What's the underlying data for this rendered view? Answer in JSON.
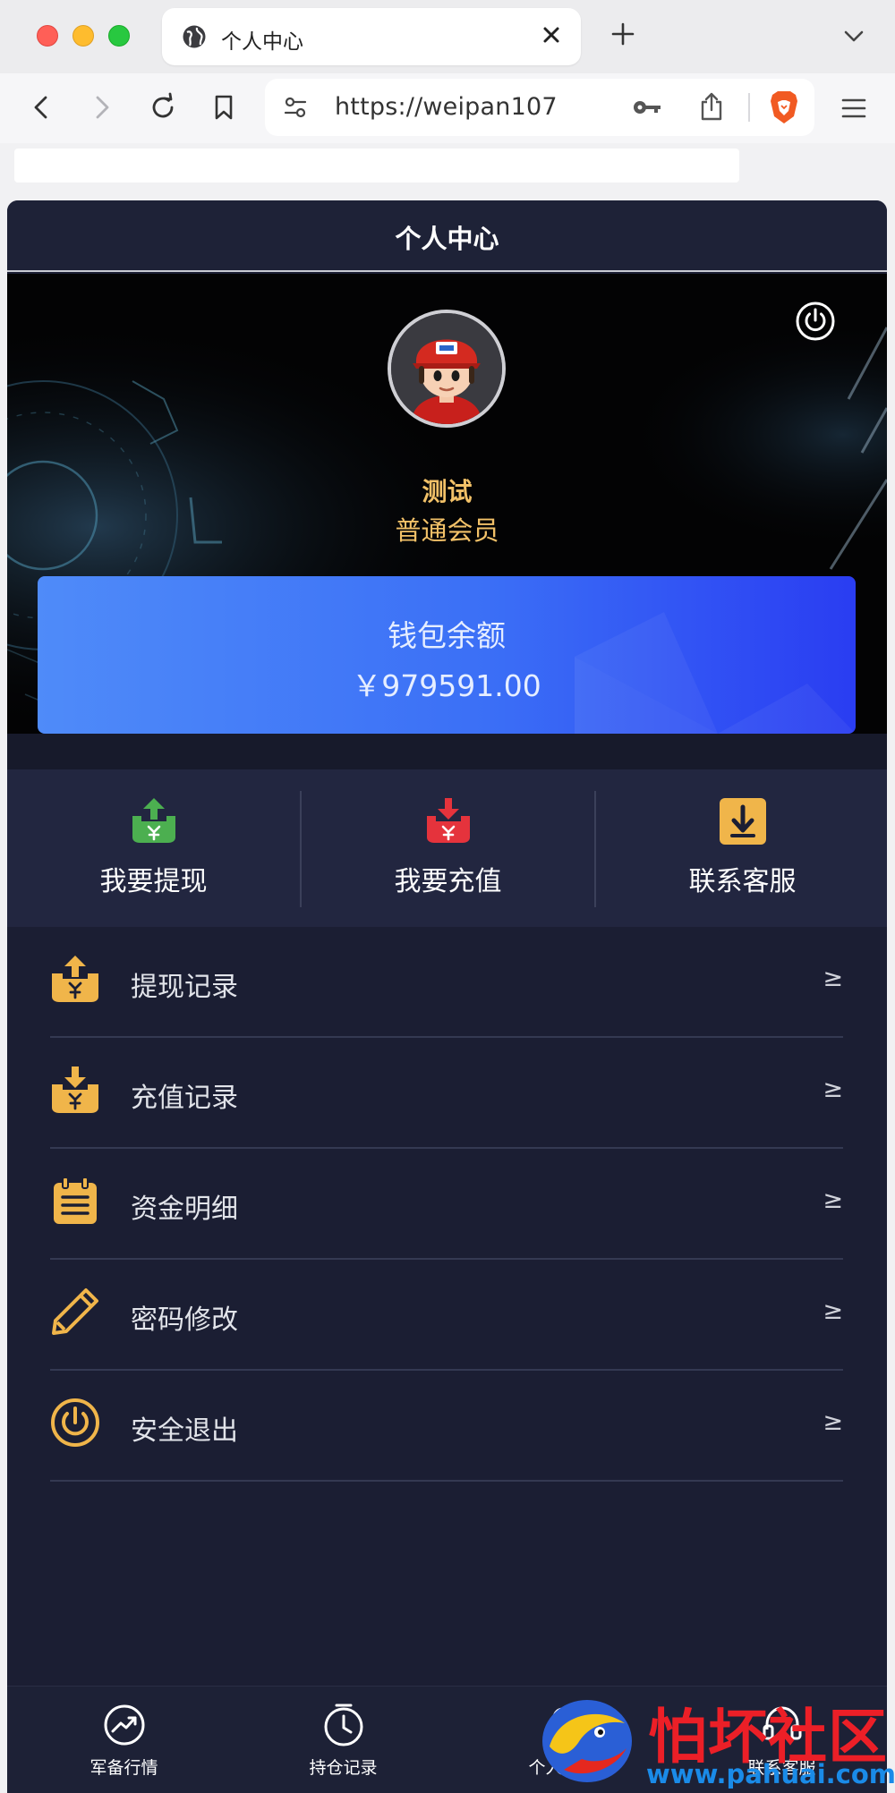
{
  "browser": {
    "tab_title": "个人中心",
    "url": "https://weipan107"
  },
  "header": {
    "title": "个人中心"
  },
  "profile": {
    "username": "测试",
    "member_level": "普通会员"
  },
  "wallet": {
    "label": "钱包余额",
    "amount": "￥979591.00"
  },
  "actions": [
    {
      "label": "我要提现",
      "icon": "withdraw-icon",
      "color": "#4caf50"
    },
    {
      "label": "我要充值",
      "icon": "recharge-icon",
      "color": "#e5333c"
    },
    {
      "label": "联系客服",
      "icon": "download-box-icon",
      "color": "#f0b54a"
    }
  ],
  "menu": [
    {
      "label": "提现记录",
      "icon": "withdraw-record-icon",
      "chevron": "≥"
    },
    {
      "label": "充值记录",
      "icon": "recharge-record-icon",
      "chevron": "≥"
    },
    {
      "label": "资金明细",
      "icon": "clipboard-icon",
      "chevron": "≥"
    },
    {
      "label": "密码修改",
      "icon": "pencil-icon",
      "chevron": "≥"
    },
    {
      "label": "安全退出",
      "icon": "power-icon",
      "chevron": "≥"
    }
  ],
  "bottom_nav": [
    {
      "label": "军备行情",
      "icon": "trend-icon"
    },
    {
      "label": "持仓记录",
      "icon": "clock-icon"
    },
    {
      "label": "个人中心",
      "icon": "user-icon"
    },
    {
      "label": "联系客服",
      "icon": "headset-icon"
    }
  ],
  "watermark": {
    "title": "怕坏社区",
    "url": "www.pahuai.com"
  },
  "colors": {
    "accent_gold": "#f2c168",
    "page_bg": "#1b1e33",
    "wallet_blue": "#3b6ff6"
  }
}
